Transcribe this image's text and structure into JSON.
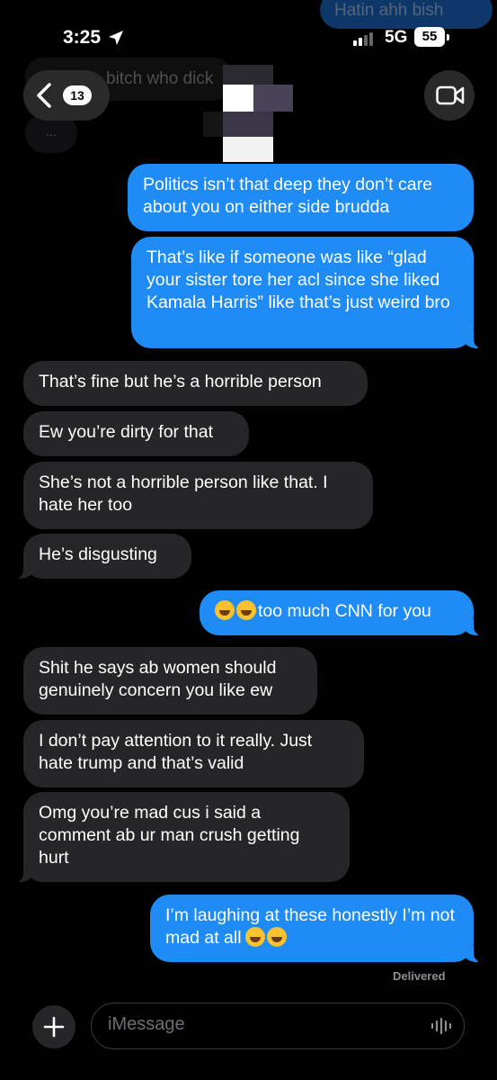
{
  "status_bar": {
    "time": "3:25",
    "network": "5G",
    "battery": "55"
  },
  "background": {
    "top_message": "Hatin ahh bish",
    "preview_message": "bitch who dick",
    "typing": "..."
  },
  "header": {
    "back_badge": "13"
  },
  "messages": [
    {
      "dir": "out",
      "text": "Politics isn’t that deep they don’t care about you on either side brudda"
    },
    {
      "dir": "out",
      "text": "That’s like if someone was like “glad your sister tore her acl since she liked Kamala Harris” like that’s just weird bro"
    },
    {
      "dir": "in",
      "text": "That’s fine but he’s a horrible person"
    },
    {
      "dir": "in",
      "text": "Ew you’re dirty for that"
    },
    {
      "dir": "in",
      "text": "She’s not a horrible person like that. I hate her too"
    },
    {
      "dir": "in",
      "text": "He’s disgusting"
    },
    {
      "dir": "out",
      "text": "too much CNN for you"
    },
    {
      "dir": "in",
      "text": "Shit he says ab women should genuinely concern you like ew"
    },
    {
      "dir": "in",
      "text": "I don’t pay attention to it really. Just hate trump and that’s valid"
    },
    {
      "dir": "in",
      "text": "Omg you’re mad cus i said a comment ab ur man crush getting hurt"
    },
    {
      "dir": "out",
      "text": "I’m laughing at these honestly I’m not mad at all"
    }
  ],
  "delivered": "Delivered",
  "input": {
    "placeholder": "iMessage"
  },
  "icons": [
    "location-arrow-icon",
    "signal-icon",
    "battery-icon",
    "chevron-left-icon",
    "video-camera-icon",
    "plus-icon",
    "voice-waveform-icon",
    "laughing-emoji-icon"
  ]
}
